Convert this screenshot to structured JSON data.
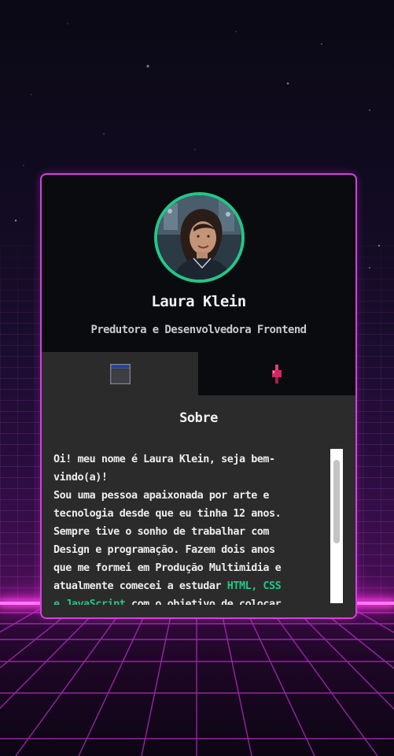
{
  "profile": {
    "name": "Laura Klein",
    "role": "Predutora e Desenvolvedora Frontend",
    "avatar_icon": "profile-photo"
  },
  "tabs": [
    {
      "icon": "browser-window-icon",
      "selected": true
    },
    {
      "icon": "hand-touch-icon",
      "selected": false
    }
  ],
  "about": {
    "title": "Sobre",
    "bio_lines": [
      "Oi! meu nome é Laura Klein, seja bem-",
      "vindo(a)!",
      "Sou uma pessoa apaixonada por arte e",
      "tecnologia desde que eu tinha 12 anos.",
      "Sempre tive o sonho de trabalhar com",
      "Design e programação. Fazem dois anos",
      "que me formei em Produção Multimidia e",
      "atualmente comecei a estudar "
    ],
    "bio_highlight_1": "HTML, CSS",
    "bio_highlight_2": "e JavaScript",
    "bio_after_highlight": " com o objetivo de colocar"
  },
  "colors": {
    "accent_green": "#22c787",
    "card_border": "#d63ee0",
    "horizon": "#ff3de6"
  }
}
